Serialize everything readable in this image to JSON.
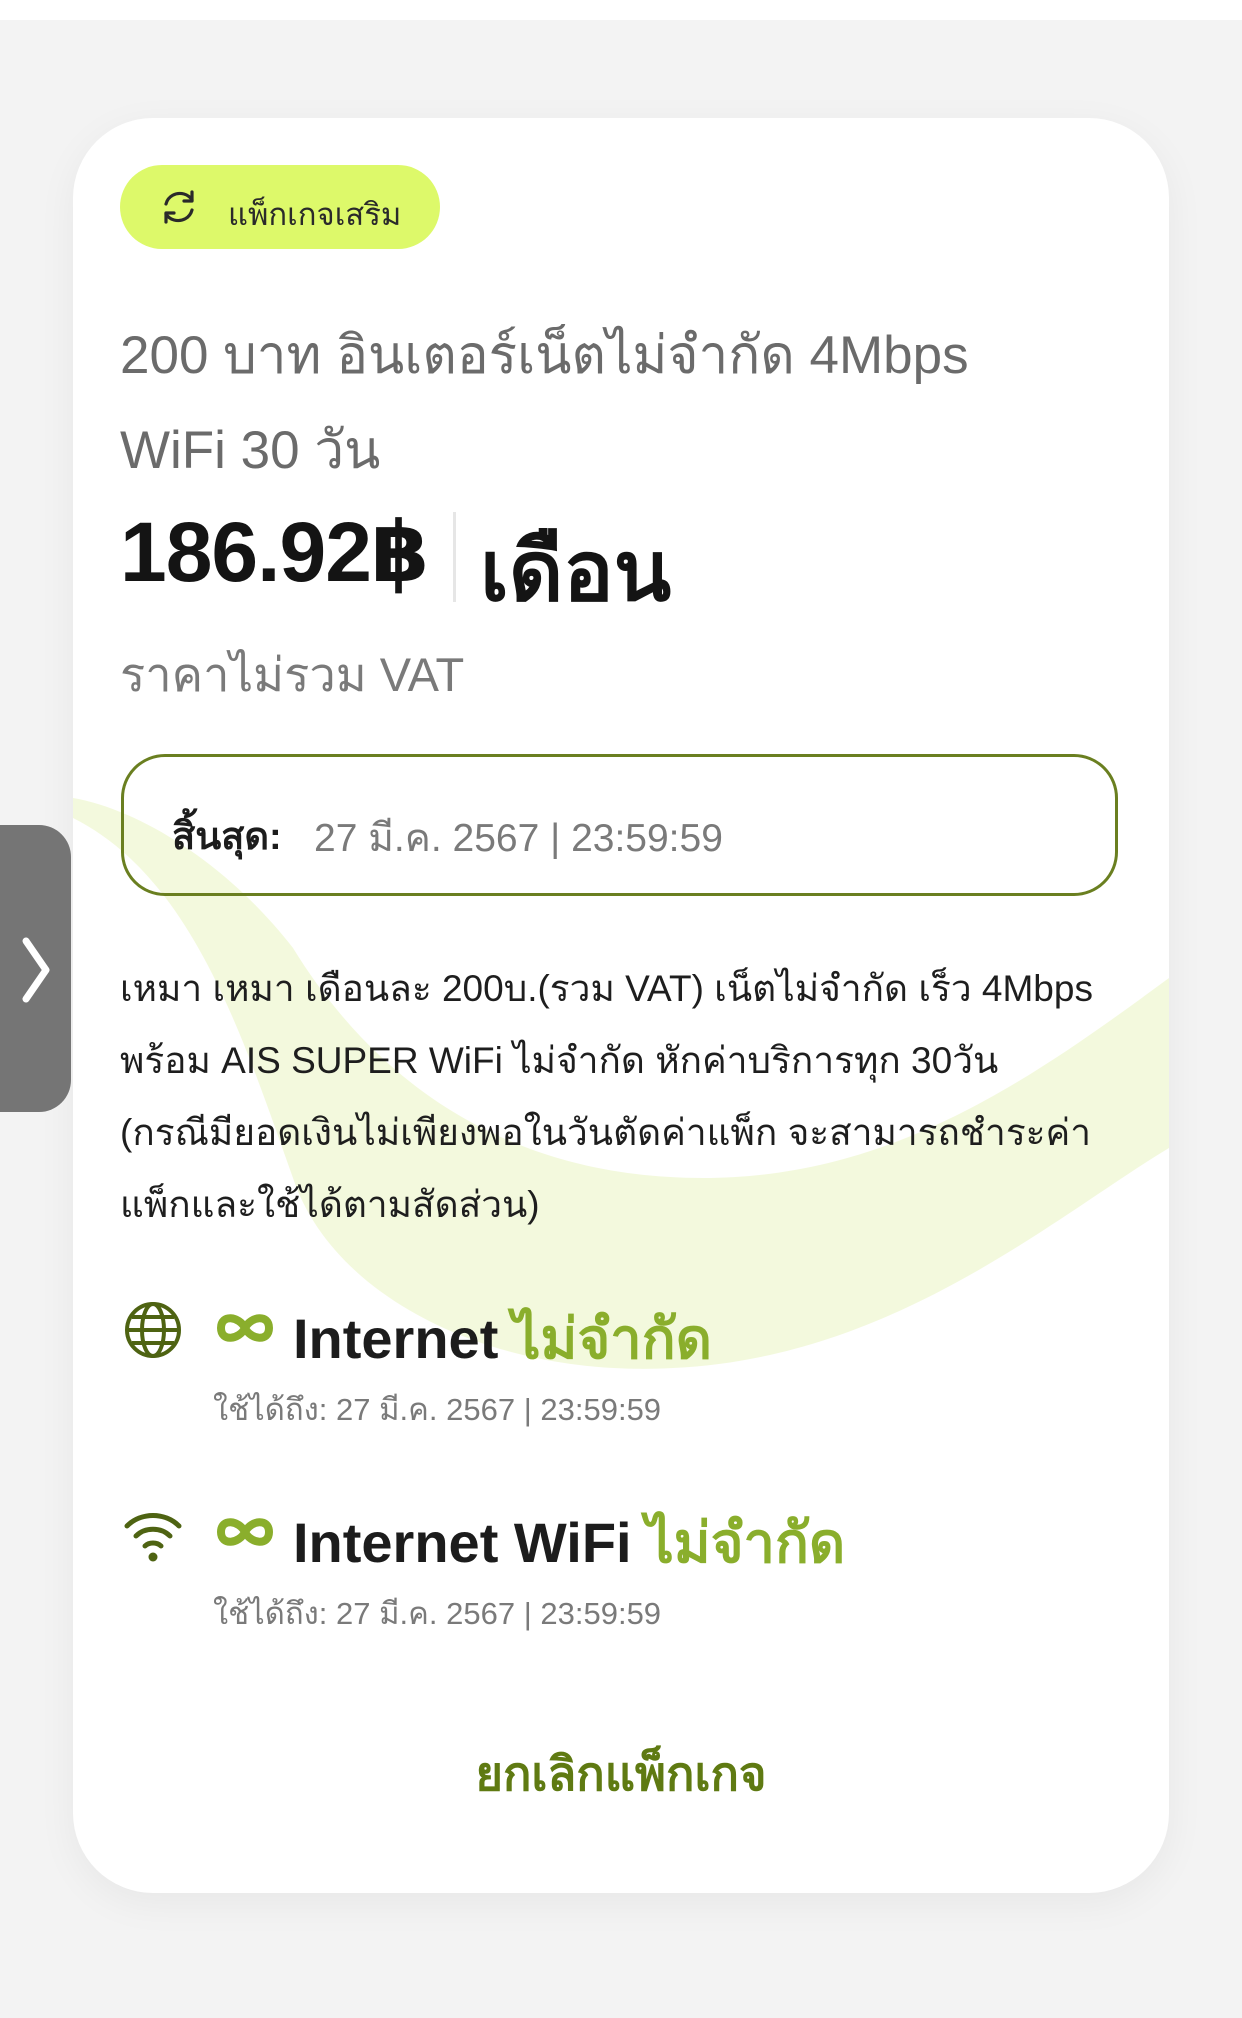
{
  "badge": {
    "label": "แพ็กเกจเสริม",
    "icon": "refresh-icon"
  },
  "package": {
    "title_line1": "200 บาท อินเตอร์เน็ตไม่จำกัด 4Mbps",
    "title_line2": "WiFi 30 วัน",
    "price": "186.92฿",
    "price_unit": "เดือน",
    "vat_note": "ราคาไม่รวม VAT"
  },
  "expiry": {
    "label": "สิ้นสุด:",
    "value": "27 มี.ค. 2567 | 23:59:59"
  },
  "description": {
    "line1": "เหมา เหมา เดือนละ 200บ.(รวม VAT) เน็ตไม่จำกัด เร็ว 4Mbps",
    "line2": "พร้อม AIS SUPER WiFi ไม่จำกัด หักค่าบริการทุก 30วัน",
    "line3": "(กรณีมียอดเงินไม่เพียงพอในวันตัดค่าแพ็ก จะสามารถชำระค่า",
    "line4": "แพ็กและใช้ได้ตามสัดส่วน)"
  },
  "features": [
    {
      "icon": "globe-icon",
      "name": "Internet",
      "highlight": "ไม่จำกัด",
      "valid_until": "ใช้ได้ถึง: 27 มี.ค. 2567 | 23:59:59"
    },
    {
      "icon": "wifi-icon",
      "name": "Internet WiFi",
      "highlight": "ไม่จำกัด",
      "valid_until": "ใช้ได้ถึง: 27 มี.ค. 2567 | 23:59:59"
    }
  ],
  "cancel_label": "ยกเลิกแพ็กเกจ",
  "side_tab": {
    "icon": "chevron-right-icon"
  },
  "colors": {
    "badge_bg": "#ddf96a",
    "accent_green": "#8aae2c",
    "dark_green": "#5f7a12",
    "border_green": "#6a7f20"
  }
}
